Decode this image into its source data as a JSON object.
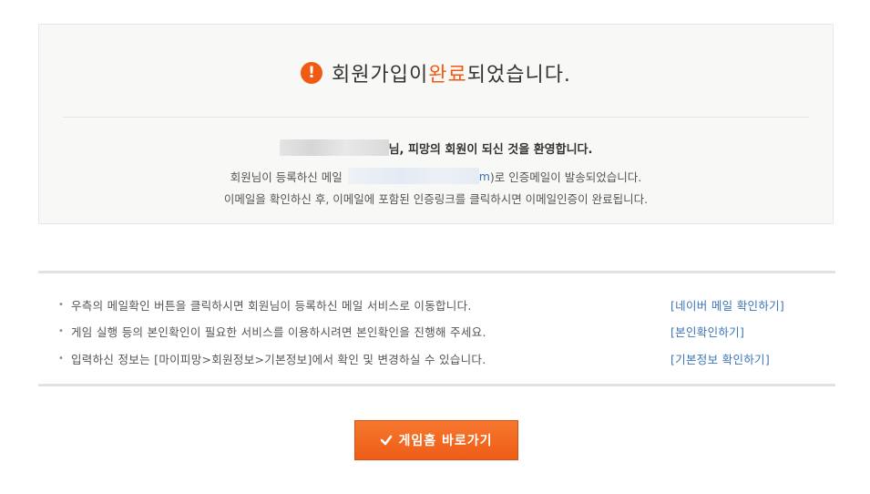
{
  "completion": {
    "title_prefix": "회원가입이 ",
    "title_highlight": "완료",
    "title_suffix": "되었습니다.",
    "alert_symbol": "!",
    "welcome_suffix": "님, 피망의 회원이 되신 것을 환영합니다.",
    "email_line_prefix": "회원님이 등록하신 메일",
    "email_visible_tail": "m",
    "email_line_suffix": ")로 인증메일이 발송되었습니다.",
    "instruction_line": "이메일을 확인하신 후, 이메일에 포함된 인증링크를 클릭하시면 이메일인증이 완료됩니다."
  },
  "guide": {
    "bullet": "•",
    "items": [
      {
        "text": "우측의 메일확인 버튼을 클릭하시면 회원님이 등록하신 메일 서비스로 이동합니다.",
        "link": "[네이버 메일 확인하기]"
      },
      {
        "text": "게임 실행 등의 본인확인이 필요한 서비스를 이용하시려면 본인확인을 진행해 주세요.",
        "link": "[본인확인하기]"
      },
      {
        "text": "입력하신 정보는 [마이피망>회원정보>기본정보]에서 확인 및 변경하실 수 있습니다.",
        "link": "[기본정보 확인하기]"
      }
    ]
  },
  "home_button": {
    "label": "게임홈 바로가기",
    "icon": "check-icon"
  },
  "colors": {
    "accent": "#f05a14",
    "link": "#3b74b8"
  }
}
